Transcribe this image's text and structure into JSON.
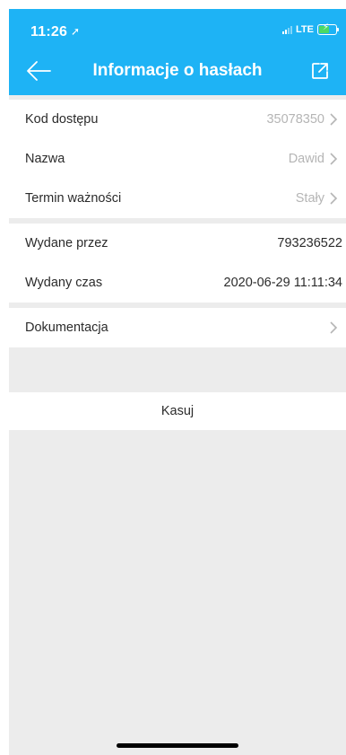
{
  "status_bar": {
    "time": "11:26",
    "network": "LTE"
  },
  "navbar": {
    "title": "Informacje o hasłach"
  },
  "details": [
    {
      "label": "Kod dostępu",
      "value": "35078350"
    },
    {
      "label": "Nazwa",
      "value": "Dawid"
    },
    {
      "label": "Termin ważności",
      "value": "Stały"
    }
  ],
  "issue_info": [
    {
      "label": "Wydane przez",
      "value": "793236522"
    },
    {
      "label": "Wydany czas",
      "value": "2020-06-29 11:11:34"
    }
  ],
  "docs": {
    "label": "Dokumentacja"
  },
  "delete_label": "Kasuj",
  "colors": {
    "accent": "#1eb3f5",
    "background": "#ececec",
    "muted_text": "#b5b5b5"
  }
}
